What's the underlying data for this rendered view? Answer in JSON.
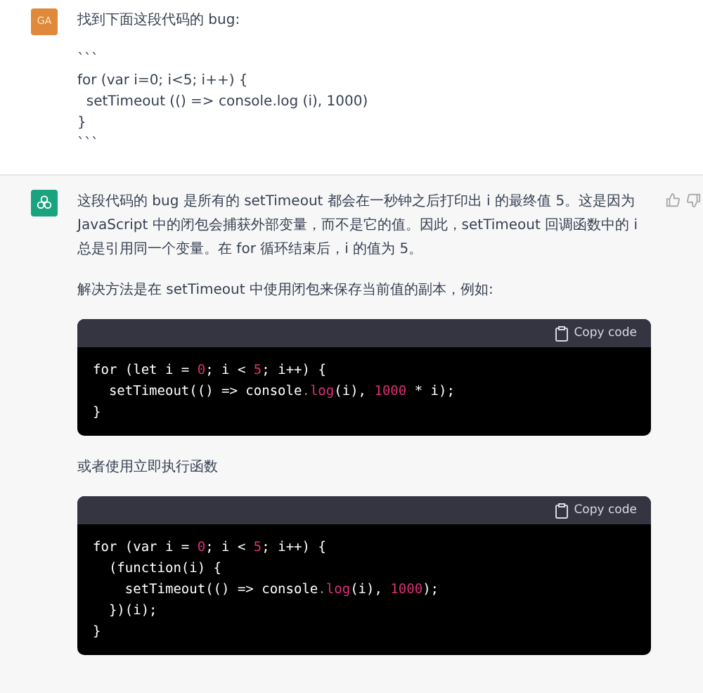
{
  "messages": [
    {
      "kind": "user",
      "avatar": "GA",
      "blocks": [
        {
          "kind": "text",
          "text": "找到下面这段代码的 bug:"
        },
        {
          "kind": "plain_code",
          "lines": [
            "```",
            "for (var i=0; i<5; i++) {",
            "  setTimeout (() => console.log (i), 1000)",
            "}",
            "```"
          ]
        }
      ]
    },
    {
      "kind": "assistant",
      "blocks": [
        {
          "kind": "text",
          "text": "这段代码的 bug 是所有的 setTimeout 都会在一秒钟之后打印出 i 的最终值 5。这是因为 JavaScript 中的闭包会捕获外部变量，而不是它的值。因此，setTimeout 回调函数中的 i 总是引用同一个变量。在 for 循环结束后，i 的值为 5。"
        },
        {
          "kind": "text",
          "text": "解决方法是在 setTimeout 中使用闭包来保存当前值的副本，例如:"
        },
        {
          "kind": "code",
          "copy_label": "Copy code",
          "lines": [
            [
              {
                "text": "for (let i = ",
                "kind": "plain"
              },
              {
                "text": "0",
                "kind": "number"
              },
              {
                "text": "; i < ",
                "kind": "plain"
              },
              {
                "text": "5",
                "kind": "number"
              },
              {
                "text": "; i++) {",
                "kind": "plain"
              }
            ],
            [
              {
                "text": "  setTimeout(() => console",
                "kind": "plain"
              },
              {
                "text": ".",
                "kind": "punct"
              },
              {
                "text": "log",
                "kind": "method"
              },
              {
                "text": "(i), ",
                "kind": "plain"
              },
              {
                "text": "1000",
                "kind": "number"
              },
              {
                "text": " * i);",
                "kind": "plain"
              }
            ],
            [
              {
                "text": "}",
                "kind": "plain"
              }
            ]
          ]
        },
        {
          "kind": "text",
          "text": "或者使用立即执行函数"
        },
        {
          "kind": "code",
          "copy_label": "Copy code",
          "lines": [
            [
              {
                "text": "for (var i = ",
                "kind": "plain"
              },
              {
                "text": "0",
                "kind": "number"
              },
              {
                "text": "; i < ",
                "kind": "plain"
              },
              {
                "text": "5",
                "kind": "number"
              },
              {
                "text": "; i++) {",
                "kind": "plain"
              }
            ],
            [
              {
                "text": "  (function(i) {",
                "kind": "plain"
              }
            ],
            [
              {
                "text": "    setTimeout(() => console",
                "kind": "plain"
              },
              {
                "text": ".",
                "kind": "punct"
              },
              {
                "text": "log",
                "kind": "method"
              },
              {
                "text": "(i), ",
                "kind": "plain"
              },
              {
                "text": "1000",
                "kind": "number"
              },
              {
                "text": ");",
                "kind": "plain"
              }
            ],
            [
              {
                "text": "  })(i);",
                "kind": "plain"
              }
            ],
            [
              {
                "text": "}",
                "kind": "plain"
              }
            ]
          ]
        }
      ]
    }
  ]
}
